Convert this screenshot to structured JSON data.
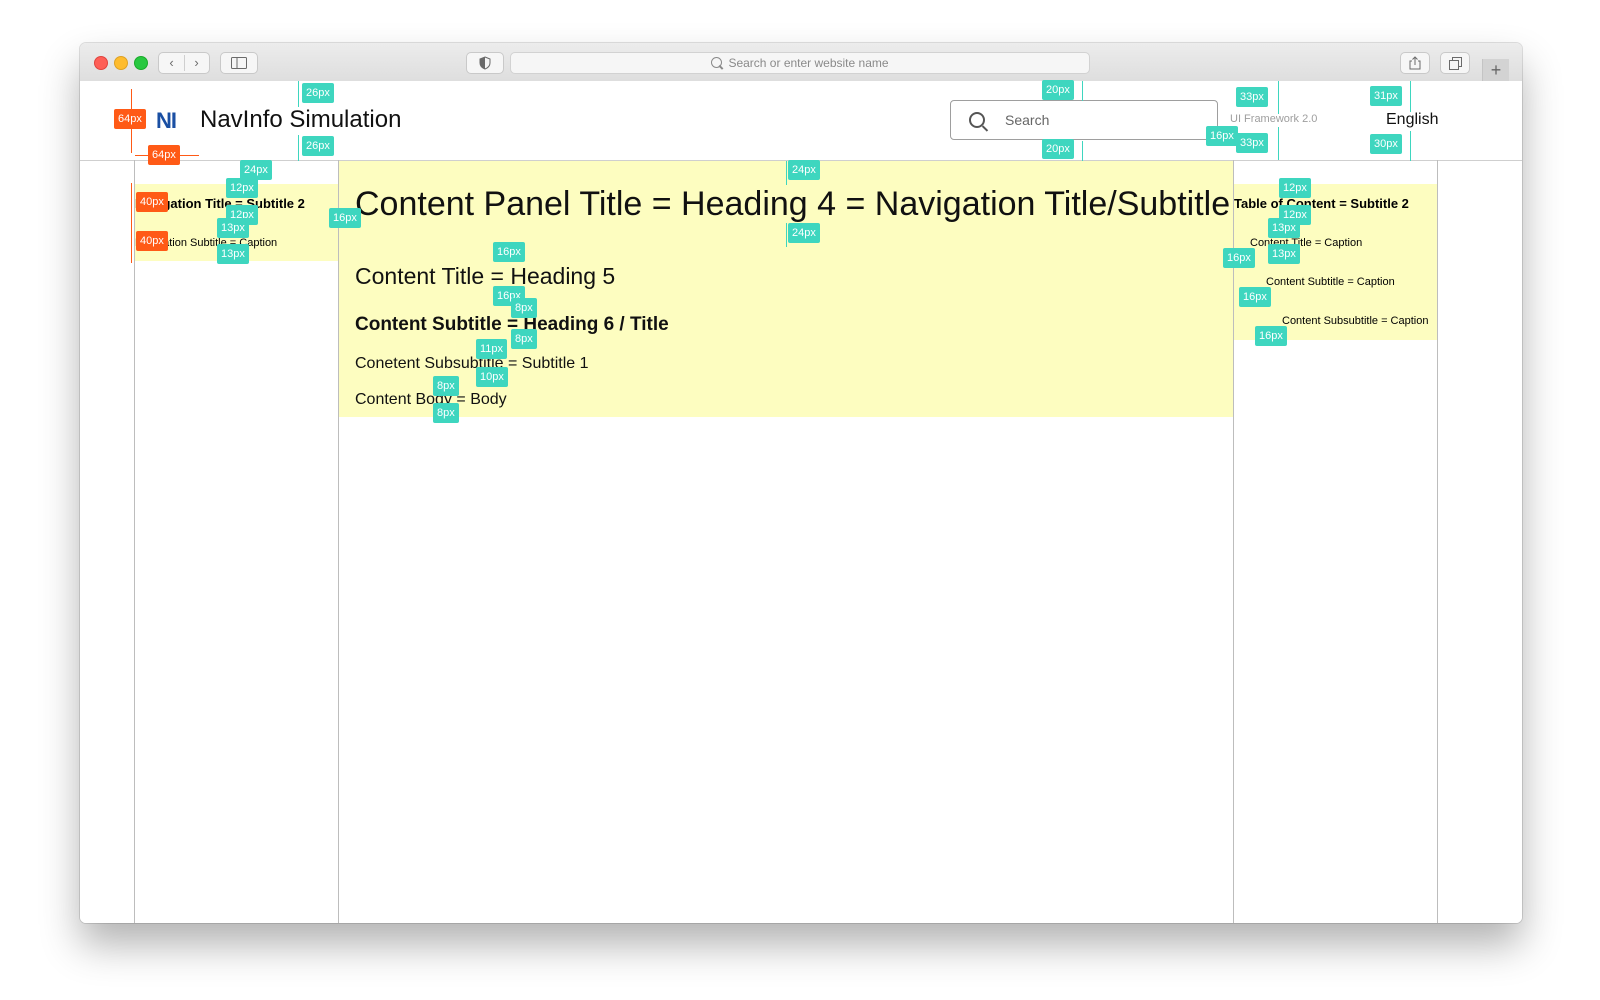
{
  "browser": {
    "address_placeholder": "Search or enter website name",
    "back_glyph": "‹",
    "forward_glyph": "›",
    "plus_glyph": "+"
  },
  "header": {
    "logo_text": "NI",
    "app_title": "NavInfo Simulation",
    "search_placeholder": "Search",
    "framework_label": "UI Framework 2.0",
    "language": "English"
  },
  "left_nav": {
    "title": "Navigation Title = Subtitle 2",
    "subtitle": "Navigation Subtitle = Caption"
  },
  "content": {
    "panel_title": "Content Panel Title = Heading 4 = Navigation Title/Subtitle",
    "title": "Content Title = Heading 5",
    "subtitle": "Content Subtitle = Heading 6 / Title",
    "subsubtitle": "Conetent Subsubtitle = Subtitle 1",
    "body": "Content Body = Body"
  },
  "toc": {
    "title": "Table of Content = Subtitle 2",
    "item_1": "Content Title = Caption",
    "item_2": "Content Subtitle = Caption",
    "item_3": "Content Subsubtitle = Caption"
  },
  "annotations": {
    "teal": [
      "26px",
      "26px",
      "20px",
      "20px",
      "33px",
      "33px",
      "31px",
      "30px",
      "16px",
      "24px",
      "12px",
      "12px",
      "13px",
      "13px",
      "24px",
      "24px",
      "16px",
      "16px",
      "16px",
      "8px",
      "8px",
      "11px",
      "10px",
      "8px",
      "8px",
      "12px",
      "12px",
      "13px",
      "13px",
      "16px",
      "16px",
      "16px"
    ],
    "orange": [
      "64px",
      "64px",
      "40px",
      "40px"
    ]
  },
  "colors": {
    "panel_highlight": "#fdfdc0",
    "annotation_teal": "#3ed6bf",
    "annotation_orange": "#ff5a16",
    "logo_blue": "#1a4fa3"
  }
}
